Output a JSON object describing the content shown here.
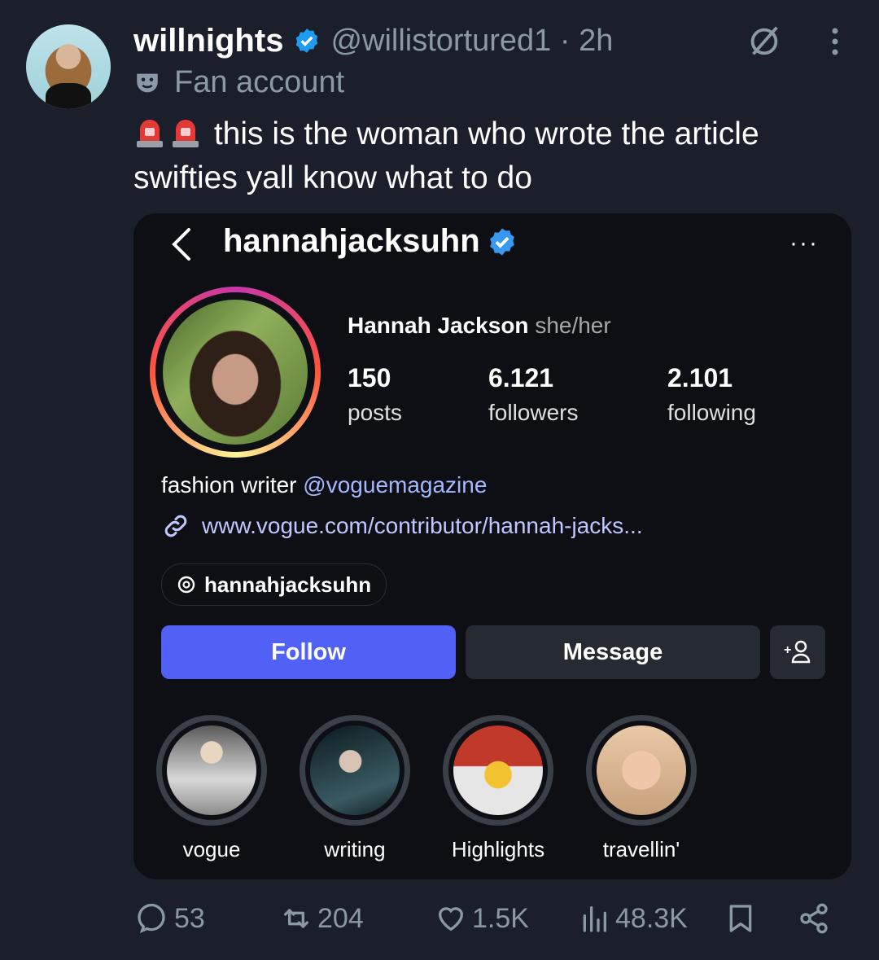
{
  "tweet": {
    "display_name": "willnights",
    "handle": "@willistortured1 · 2h",
    "label": "Fan account",
    "text": "this is the woman who wrote the article swifties yall know what to do"
  },
  "instagram": {
    "username": "hannahjacksuhn",
    "more": "···",
    "full_name": "Hannah Jackson",
    "pronouns": "she/her",
    "stats": [
      {
        "value": "150",
        "label": "posts"
      },
      {
        "value": "6.121",
        "label": "followers"
      },
      {
        "value": "2.101",
        "label": "following"
      }
    ],
    "bio_prefix": "fashion writer ",
    "bio_mention": "@voguemagazine",
    "link": "www.vogue.com/contributor/hannah-jacks...",
    "threads_handle": "hannahjacksuhn",
    "follow_label": "Follow",
    "message_label": "Message",
    "adduser_label": "+",
    "highlights": [
      "vogue",
      "writing",
      "Highlights",
      "travellin'"
    ]
  },
  "actions": {
    "replies": "53",
    "reposts": "204",
    "likes": "1.5K",
    "views": "48.3K"
  },
  "colors": {
    "background": "#1a1f2b",
    "card": "#0d0f14",
    "follow_button": "#5161f5",
    "verified": "#1d9bf0",
    "muted": "#8b98a5"
  },
  "icons": [
    "verified-badge-icon",
    "grok-icon",
    "more-icon",
    "theater-mask-icon",
    "siren-icon",
    "back-chevron-icon",
    "link-icon",
    "threads-icon",
    "add-user-icon",
    "reply-icon",
    "repost-icon",
    "like-icon",
    "views-icon",
    "bookmark-icon",
    "share-icon"
  ]
}
